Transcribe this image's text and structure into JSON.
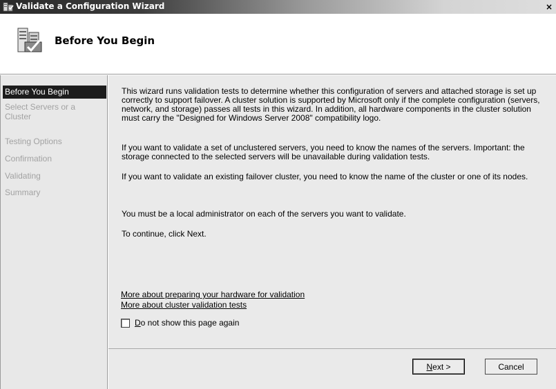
{
  "window": {
    "title": "Validate a Configuration Wizard",
    "close_glyph": "×",
    "icon": "cluster-validation-icon"
  },
  "header": {
    "title": "Before You Begin",
    "icon": "cluster-validation-icon"
  },
  "sidebar": {
    "items": [
      {
        "label": "Before You Begin",
        "active": true
      },
      {
        "label": "Select Servers or a Cluster",
        "active": false
      },
      {
        "label": "Testing Options",
        "active": false
      },
      {
        "label": "Confirmation",
        "active": false
      },
      {
        "label": "Validating",
        "active": false
      },
      {
        "label": "Summary",
        "active": false
      }
    ]
  },
  "main": {
    "paragraphs": [
      "This wizard runs validation tests to determine whether this configuration of servers and attached storage is set up correctly to support failover. A cluster solution is supported by Microsoft only if the complete configuration (servers, network, and storage) passes all tests in this wizard. In addition, all hardware components in the cluster solution must carry the \"Designed for Windows Server 2008\" compatibility logo.",
      "If you want to validate a set of unclustered servers, you need to know the names of the servers. Important: the storage connected to the selected servers will be unavailable during validation tests.",
      "If you want to validate an existing failover cluster, you need to know the name of the cluster or one of its nodes.",
      "You must be a local administrator on each of the servers you want to validate.",
      "To continue, click Next."
    ],
    "links": [
      "More about preparing your hardware for validation",
      "More about cluster validation tests"
    ],
    "checkbox": {
      "label_accel": "D",
      "label_rest": "o not show this page again",
      "checked": false
    }
  },
  "buttons": {
    "next_accel": "N",
    "next_rest": "ext >",
    "cancel": "Cancel"
  }
}
